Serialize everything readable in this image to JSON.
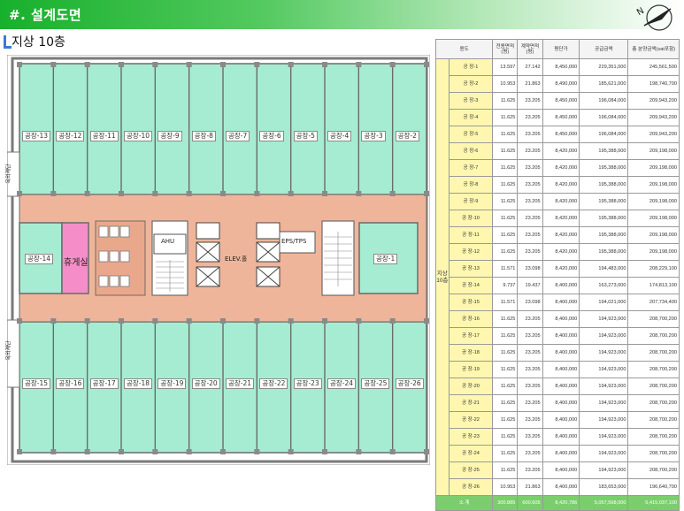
{
  "header": {
    "title": "#. 설계도면"
  },
  "floor": {
    "title": "지상 10층"
  },
  "plan": {
    "top_rooms": [
      "공장-13",
      "공장-12",
      "공장-11",
      "공장-10",
      "공장-9",
      "공장-8",
      "공장-7",
      "공장-6",
      "공장-5",
      "공장-4",
      "공장-3",
      "공장-2"
    ],
    "bottom_rooms": [
      "공장-15",
      "공장-16",
      "공장-17",
      "공장-18",
      "공장-19",
      "공장-20",
      "공장-21",
      "공장-22",
      "공장-23",
      "공장-24",
      "공장-25",
      "공장-26"
    ],
    "left_room": "공장-14",
    "right_room": "공장-1",
    "lounge": "휴게실",
    "ahu": "AHU",
    "eps": "EPS/TPS",
    "elev_hall": "ELEV.홀",
    "side_left_upper": "옥외계단",
    "side_left_lower": "옥외계단"
  },
  "table": {
    "headers": [
      "용도",
      "전용면적(평)",
      "계약면적(평)",
      "평단가",
      "공급금액",
      "총 분양금액(vat포함)"
    ],
    "floor_label": "지상 10층",
    "rows": [
      {
        "unit": "공 장-1",
        "excl": "13.597",
        "contract": "27.142",
        "unit_price": "8,450,000",
        "supply": "229,351,000",
        "total": "245,561,500"
      },
      {
        "unit": "공 장-2",
        "excl": "10.953",
        "contract": "21.863",
        "unit_price": "8,490,000",
        "supply": "185,621,000",
        "total": "198,740,700"
      },
      {
        "unit": "공 장-3",
        "excl": "11.625",
        "contract": "23.205",
        "unit_price": "8,450,000",
        "supply": "196,084,000",
        "total": "209,943,200"
      },
      {
        "unit": "공 장-4",
        "excl": "11.625",
        "contract": "23.205",
        "unit_price": "8,450,000",
        "supply": "196,084,000",
        "total": "209,943,200"
      },
      {
        "unit": "공 장-5",
        "excl": "11.625",
        "contract": "23.205",
        "unit_price": "8,450,000",
        "supply": "196,084,000",
        "total": "209,943,200"
      },
      {
        "unit": "공 장-6",
        "excl": "11.625",
        "contract": "23.205",
        "unit_price": "8,420,000",
        "supply": "195,388,000",
        "total": "209,198,000"
      },
      {
        "unit": "공 장-7",
        "excl": "11.625",
        "contract": "23.205",
        "unit_price": "8,420,000",
        "supply": "195,388,000",
        "total": "209,198,000"
      },
      {
        "unit": "공 장-8",
        "excl": "11.625",
        "contract": "23.205",
        "unit_price": "8,420,000",
        "supply": "195,388,000",
        "total": "209,198,000"
      },
      {
        "unit": "공 장-9",
        "excl": "11.625",
        "contract": "23.205",
        "unit_price": "8,420,000",
        "supply": "195,388,000",
        "total": "209,198,000"
      },
      {
        "unit": "공 장-10",
        "excl": "11.625",
        "contract": "23.205",
        "unit_price": "8,420,000",
        "supply": "195,388,000",
        "total": "209,198,000"
      },
      {
        "unit": "공 장-11",
        "excl": "11.625",
        "contract": "23.205",
        "unit_price": "8,420,000",
        "supply": "195,388,000",
        "total": "209,198,000"
      },
      {
        "unit": "공 장-12",
        "excl": "11.625",
        "contract": "23.205",
        "unit_price": "8,420,000",
        "supply": "195,388,000",
        "total": "209,198,000"
      },
      {
        "unit": "공 장-13",
        "excl": "11.571",
        "contract": "23.098",
        "unit_price": "8,420,000",
        "supply": "194,483,000",
        "total": "208,229,100"
      },
      {
        "unit": "공 장-14",
        "excl": "9.737",
        "contract": "19.437",
        "unit_price": "8,400,000",
        "supply": "163,273,000",
        "total": "174,813,100"
      },
      {
        "unit": "공 장-15",
        "excl": "11.571",
        "contract": "23.098",
        "unit_price": "8,400,000",
        "supply": "194,021,000",
        "total": "207,734,400"
      },
      {
        "unit": "공 장-16",
        "excl": "11.625",
        "contract": "23.205",
        "unit_price": "8,400,000",
        "supply": "194,923,000",
        "total": "208,700,200"
      },
      {
        "unit": "공 장-17",
        "excl": "11.625",
        "contract": "23.205",
        "unit_price": "8,400,000",
        "supply": "194,923,000",
        "total": "208,700,200"
      },
      {
        "unit": "공 장-18",
        "excl": "11.625",
        "contract": "23.205",
        "unit_price": "8,400,000",
        "supply": "194,923,000",
        "total": "208,700,200"
      },
      {
        "unit": "공 장-19",
        "excl": "11.625",
        "contract": "23.205",
        "unit_price": "8,400,000",
        "supply": "194,923,000",
        "total": "208,700,200"
      },
      {
        "unit": "공 장-20",
        "excl": "11.625",
        "contract": "23.205",
        "unit_price": "8,400,000",
        "supply": "194,923,000",
        "total": "208,700,200"
      },
      {
        "unit": "공 장-21",
        "excl": "11.625",
        "contract": "23.205",
        "unit_price": "8,400,000",
        "supply": "194,923,000",
        "total": "208,700,200"
      },
      {
        "unit": "공 장-22",
        "excl": "11.625",
        "contract": "23.205",
        "unit_price": "8,400,000",
        "supply": "194,923,000",
        "total": "208,700,200"
      },
      {
        "unit": "공 장-23",
        "excl": "11.625",
        "contract": "23.205",
        "unit_price": "8,400,000",
        "supply": "194,923,000",
        "total": "208,700,200"
      },
      {
        "unit": "공 장-24",
        "excl": "11.625",
        "contract": "23.205",
        "unit_price": "8,400,000",
        "supply": "194,923,000",
        "total": "208,700,200"
      },
      {
        "unit": "공 장-25",
        "excl": "11.625",
        "contract": "23.205",
        "unit_price": "8,400,000",
        "supply": "194,923,000",
        "total": "208,700,200"
      },
      {
        "unit": "공 장-26",
        "excl": "10.953",
        "contract": "21.863",
        "unit_price": "8,400,000",
        "supply": "183,653,000",
        "total": "196,640,700"
      }
    ],
    "total": {
      "label": "소 계",
      "excl": "300.885",
      "contract": "600.605",
      "unit_price": "8,420,786",
      "supply": "5,057,568,000",
      "total": "5,415,037,100"
    }
  },
  "colors": {
    "header_green": "#17b02c",
    "unit_fill": "#a6ecd2",
    "corridor_fill": "#efb59a",
    "lounge_fill": "#f58ec8",
    "wall": "#6b6b6b",
    "total_row": "#7ccd6e",
    "table_yellow": "#fff7b0"
  }
}
